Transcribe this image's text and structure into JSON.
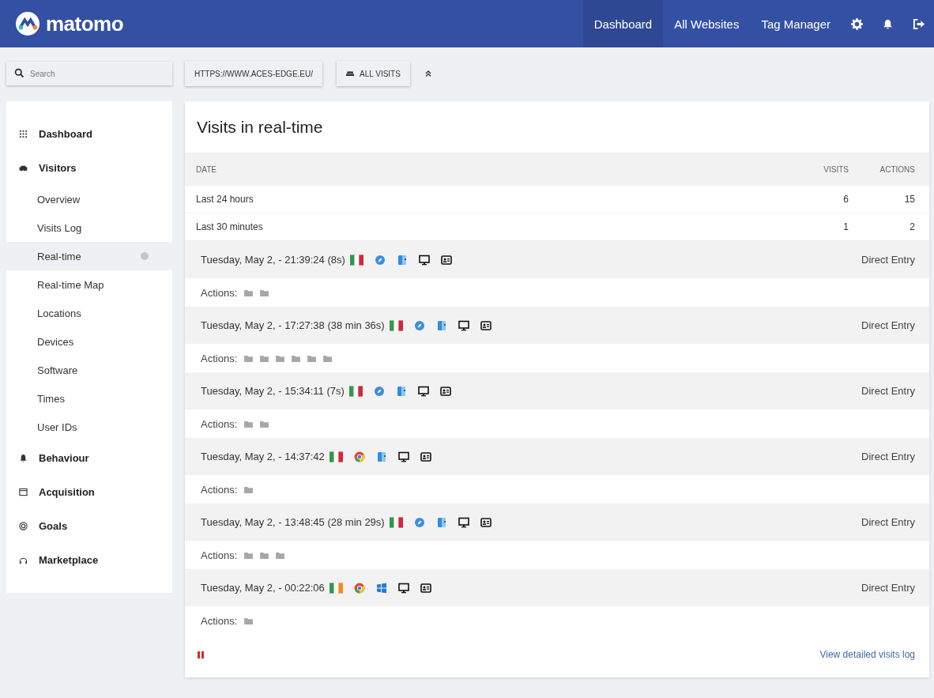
{
  "header": {
    "logo": "matomo",
    "nav": [
      {
        "label": "Dashboard",
        "selected": true
      },
      {
        "label": "All Websites",
        "selected": false
      },
      {
        "label": "Tag Manager",
        "selected": false
      }
    ]
  },
  "toolbar": {
    "search": {
      "placeholder": "Search"
    },
    "site": "HTTPS://WWW.ACES-EDGE.EU/",
    "segment": "ALL VISITS"
  },
  "sidebar": {
    "items": [
      {
        "label": "Dashboard",
        "selected": false
      },
      {
        "label": "Visitors",
        "selected": false,
        "children": [
          {
            "label": "Overview",
            "selected": false
          },
          {
            "label": "Visits Log",
            "selected": false
          },
          {
            "label": "Real-time",
            "selected": true
          },
          {
            "label": "Real-time Map",
            "selected": false
          },
          {
            "label": "Locations",
            "selected": false
          },
          {
            "label": "Devices",
            "selected": false
          },
          {
            "label": "Software",
            "selected": false
          },
          {
            "label": "Times",
            "selected": false
          },
          {
            "label": "User IDs",
            "selected": false
          }
        ]
      },
      {
        "label": "Behaviour",
        "selected": false
      },
      {
        "label": "Acquisition",
        "selected": false
      },
      {
        "label": "Goals",
        "selected": false
      },
      {
        "label": "Marketplace",
        "selected": false
      }
    ]
  },
  "widget": {
    "title": "Visits in real-time",
    "columns": [
      "DATE",
      "VISITS",
      "ACTIONS"
    ],
    "rows": [
      {
        "date": "Last 24 hours",
        "visits": "6",
        "actions": "15"
      },
      {
        "date": "Last 30 minutes",
        "visits": "1",
        "actions": "2"
      }
    ],
    "visits": [
      {
        "time": "Tuesday, May 2, - 21:39:24 (8s)",
        "icons": [
          {
            "kind": "italy"
          },
          {
            "kind": "safari"
          },
          {
            "kind": "mac"
          }
        ],
        "referrer": "Direct Entry",
        "actions_label": "Actions:",
        "actions": [
          {
            "kind": "page"
          },
          {
            "kind": "page"
          }
        ]
      },
      {
        "time": "Tuesday, May 2, - 17:27:38 (38 min 36s)",
        "icons": [
          {
            "kind": "italy"
          },
          {
            "kind": "safari"
          },
          {
            "kind": "mac"
          }
        ],
        "referrer": "Direct Entry",
        "actions_label": "Actions:",
        "actions": [
          {
            "kind": "page"
          },
          {
            "kind": "page"
          },
          {
            "kind": "page"
          },
          {
            "kind": "page"
          },
          {
            "kind": "page"
          },
          {
            "kind": "page"
          }
        ]
      },
      {
        "time": "Tuesday, May 2, - 15:34:11 (7s)",
        "icons": [
          {
            "kind": "italy"
          },
          {
            "kind": "safari"
          },
          {
            "kind": "mac"
          }
        ],
        "referrer": "Direct Entry",
        "actions_label": "Actions:",
        "actions": [
          {
            "kind": "page"
          },
          {
            "kind": "page"
          }
        ]
      },
      {
        "time": "Tuesday, May 2, - 14:37:42",
        "icons": [
          {
            "kind": "italy"
          },
          {
            "kind": "chrome"
          },
          {
            "kind": "mac"
          }
        ],
        "referrer": "Direct Entry",
        "actions_label": "Actions:",
        "actions": [
          {
            "kind": "page"
          }
        ]
      },
      {
        "time": "Tuesday, May 2, - 13:48:45 (28 min 29s)",
        "icons": [
          {
            "kind": "italy"
          },
          {
            "kind": "safari"
          },
          {
            "kind": "mac"
          }
        ],
        "referrer": "Direct Entry",
        "actions_label": "Actions:",
        "actions": [
          {
            "kind": "page"
          },
          {
            "kind": "page"
          },
          {
            "kind": "page"
          }
        ]
      },
      {
        "time": "Tuesday, May 2, - 00:22:06",
        "icons": [
          {
            "kind": "ireland"
          },
          {
            "kind": "chrome"
          },
          {
            "kind": "windows"
          }
        ],
        "referrer": "Direct Entry",
        "actions_label": "Actions:",
        "actions": [
          {
            "kind": "page"
          }
        ]
      }
    ],
    "footer_link": "View detailed visits log"
  }
}
